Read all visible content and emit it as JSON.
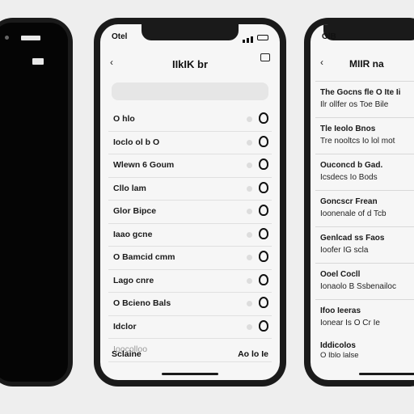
{
  "left_phone": {
    "status": {
      "time": ""
    }
  },
  "middle_phone": {
    "status": {
      "time": "Otel"
    },
    "nav": {
      "back": "‹",
      "title": "IIkIK br"
    },
    "search": {
      "placeholder": ""
    },
    "rows": [
      {
        "label": "O hlo"
      },
      {
        "label": "Ioclo ol b O"
      },
      {
        "label": "Wlewn 6 Goum"
      },
      {
        "label": "Cllo lam"
      },
      {
        "label": "Glor Bipce"
      },
      {
        "label": "Iaao gcne"
      },
      {
        "label": "O Bamcid cmm"
      },
      {
        "label": "Lago cnre"
      },
      {
        "label": "O Bcieno Bals"
      },
      {
        "label": "Idclor"
      },
      {
        "label": "Ioocolloo"
      }
    ],
    "footer": {
      "left": "Sclaine",
      "right": "Ao lo Ie"
    }
  },
  "right_phone": {
    "status": {
      "time": "OlB"
    },
    "nav": {
      "back": "‹",
      "title": "MIIR na"
    },
    "cards": [
      {
        "line1": "The Gocns fle O Ite Ii",
        "line2": "Ilr ollfer os Toe Bile"
      },
      {
        "line1": "Tle Ieolo Bnos",
        "line2": "Tre nooltcs Io lol mot"
      },
      {
        "line1": "Ouconcd b Gad.",
        "line2": "Icsdecs Io Bods"
      },
      {
        "line1": "Goncscr Frean",
        "line2": "Ioonenale of d Tcb"
      },
      {
        "line1": "Genlcad ss Faos",
        "line2": "Ioofer IG scla"
      },
      {
        "line1": "Ooel Cocll",
        "line2": "Ionaolo B Ssbenailoc"
      },
      {
        "line1": "Ifoo Ieeras",
        "line2": "Ionear Is O Cr Ie"
      }
    ],
    "footer": {
      "line1": "Iddicolos",
      "line2": "O Iblo lalse"
    }
  }
}
